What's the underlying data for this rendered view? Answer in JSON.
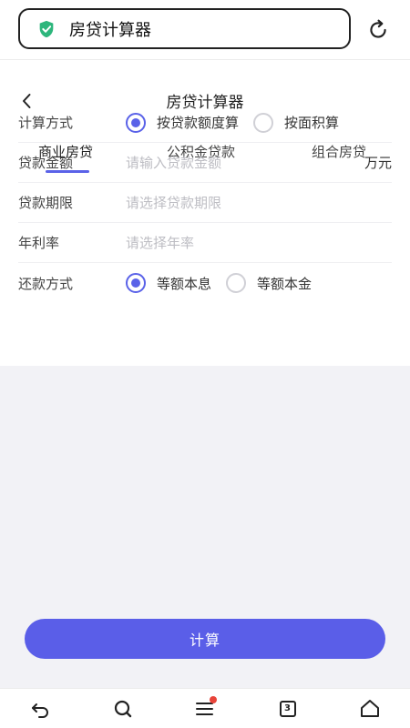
{
  "browser": {
    "url_text": "房贷计算器",
    "shield_icon": "shield-check-icon",
    "refresh_icon": "refresh-icon"
  },
  "page": {
    "title": "房贷计算器",
    "back_icon": "chevron-left-icon"
  },
  "tabs": [
    {
      "label": "商业房贷",
      "active": true
    },
    {
      "label": "公积金贷款",
      "active": false
    },
    {
      "label": "组合房贷",
      "active": false
    }
  ],
  "form": {
    "method": {
      "label": "计算方式",
      "options": [
        {
          "label": "按贷款额度算",
          "selected": true
        },
        {
          "label": "按面积算",
          "selected": false
        }
      ]
    },
    "amount": {
      "label": "贷款金额",
      "placeholder": "请输入贷款金额",
      "unit": "万元"
    },
    "term": {
      "label": "贷款期限",
      "placeholder": "请选择贷款期限"
    },
    "rate": {
      "label": "年利率",
      "placeholder": "请选择年率"
    },
    "repay": {
      "label": "还款方式",
      "options": [
        {
          "label": "等额本息",
          "selected": true
        },
        {
          "label": "等额本金",
          "selected": false
        }
      ]
    }
  },
  "calculate_label": "计算",
  "bottom_nav": {
    "items": [
      "back-arrow-icon",
      "search-icon",
      "menu-icon",
      "tabs-icon",
      "home-icon"
    ],
    "tab_count": "3"
  },
  "colors": {
    "accent": "#5a5ee8",
    "badge": "#e8443a",
    "shield": "#2db67c"
  }
}
